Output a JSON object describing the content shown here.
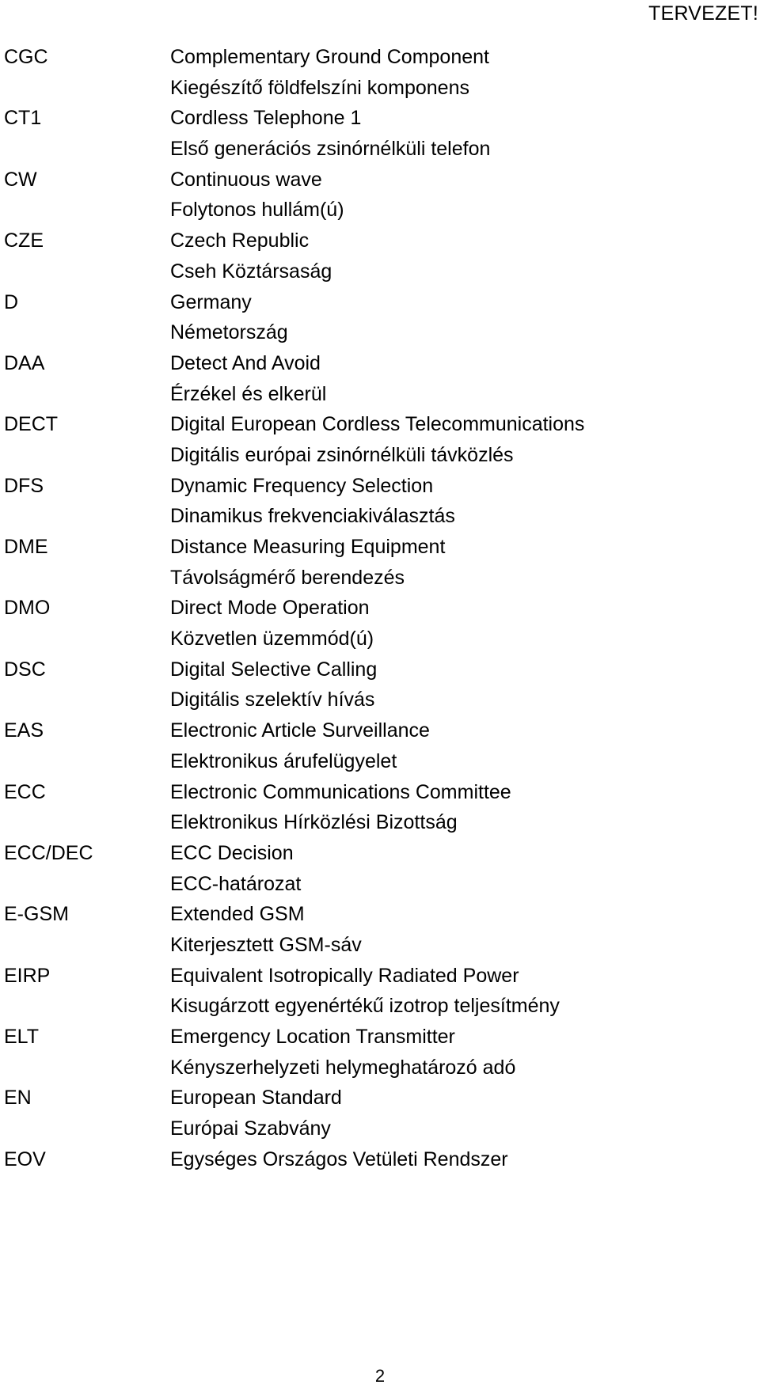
{
  "header": {
    "draft_notice": "TERVEZET!"
  },
  "footer": {
    "page_number": "2"
  },
  "glossary": {
    "entries": [
      {
        "abbr": "CGC",
        "english": "Complementary Ground Component",
        "hungarian": "Kiegészítő földfelszíni komponens"
      },
      {
        "abbr": "CT1",
        "english": "Cordless Telephone 1",
        "hungarian": "Első generációs zsinórnélküli telefon"
      },
      {
        "abbr": "CW",
        "english": "Continuous wave",
        "hungarian": "Folytonos hullám(ú)"
      },
      {
        "abbr": "CZE",
        "english": "Czech Republic",
        "hungarian": "Cseh Köztársaság"
      },
      {
        "abbr": "D",
        "english": "Germany",
        "hungarian": "Németország"
      },
      {
        "abbr": "DAA",
        "english": "Detect And Avoid",
        "hungarian": "Érzékel és elkerül"
      },
      {
        "abbr": "DECT",
        "english": "Digital European Cordless Telecommunications",
        "hungarian": "Digitális európai zsinórnélküli távközlés"
      },
      {
        "abbr": "DFS",
        "english": "Dynamic Frequency Selection",
        "hungarian": "Dinamikus frekvenciakiválasztás"
      },
      {
        "abbr": "DME",
        "english": "Distance Measuring Equipment",
        "hungarian": "Távolságmérő berendezés"
      },
      {
        "abbr": "DMO",
        "english": "Direct Mode Operation",
        "hungarian": "Közvetlen üzemmód(ú)"
      },
      {
        "abbr": "DSC",
        "english": "Digital Selective Calling",
        "hungarian": "Digitális szelektív hívás"
      },
      {
        "abbr": "EAS",
        "english": "Electronic Article Surveillance",
        "hungarian": "Elektronikus árufelügyelet"
      },
      {
        "abbr": "ECC",
        "english": "Electronic Communications Committee",
        "hungarian": "Elektronikus Hírközlési Bizottság"
      },
      {
        "abbr": "ECC/DEC",
        "english": "ECC Decision",
        "hungarian": "ECC-határozat"
      },
      {
        "abbr": "E-GSM",
        "english": "Extended GSM",
        "hungarian": "Kiterjesztett GSM-sáv"
      },
      {
        "abbr": "EIRP",
        "english": "Equivalent Isotropically Radiated Power",
        "hungarian": "Kisugárzott egyenértékű izotrop teljesítmény"
      },
      {
        "abbr": "ELT",
        "english": "Emergency Location Transmitter",
        "hungarian": "Kényszerhelyzeti helymeghatározó adó"
      },
      {
        "abbr": "EN",
        "english": "European Standard",
        "hungarian": "Európai Szabvány"
      },
      {
        "abbr": "EOV",
        "english": "Egységes Országos Vetületi Rendszer",
        "hungarian": ""
      }
    ]
  }
}
